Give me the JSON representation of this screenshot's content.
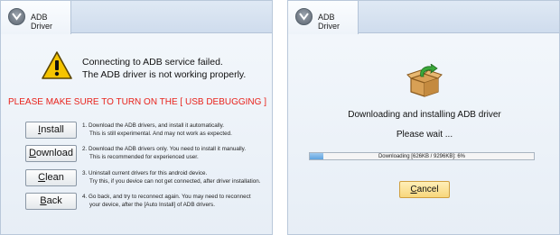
{
  "left": {
    "tab_label": "ADB Driver",
    "message_line1": "Connecting to ADB service failed.",
    "message_line2": "The ADB driver is not working properly.",
    "red_note": "PLEASE MAKE SURE TO TURN ON THE [ USB DEBUGGING ]",
    "actions": [
      {
        "label_first": "I",
        "label_rest": "nstall",
        "desc_line1": "1. Download the ADB drivers, and install it automatically.",
        "desc_line2": "This is still experimental. And may not work as expected."
      },
      {
        "label_first": "D",
        "label_rest": "ownload",
        "desc_line1": "2. Download the ADB drivers only. You need to install it manually.",
        "desc_line2": "This is recommended for experienced user."
      },
      {
        "label_first": "C",
        "label_rest": "lean",
        "desc_line1": "3. Uninstall current drivers for this android device.",
        "desc_line2": "Try this, if you device can not get connected, after driver installation."
      },
      {
        "label_first": "B",
        "label_rest": "ack",
        "desc_line1": "4. Go back, and try to reconnect again. You may need to reconnect",
        "desc_line2": "your device, after the [Auto Install] of ADB drivers."
      }
    ],
    "colors": {
      "warning_text": "#e8231c",
      "warning_icon": "#f5c400"
    }
  },
  "right": {
    "tab_label": "ADB Driver",
    "title": "Downloading and installing ADB driver",
    "wait": "Please wait ...",
    "progress_text": "Downloading [626KB / 9296KB]: 6%",
    "progress_fraction": 0.06,
    "cancel_first": "C",
    "cancel_rest": "ancel",
    "colors": {
      "cancel_bg": "#f8d77c",
      "progress_fill": "#5ea3df"
    }
  }
}
